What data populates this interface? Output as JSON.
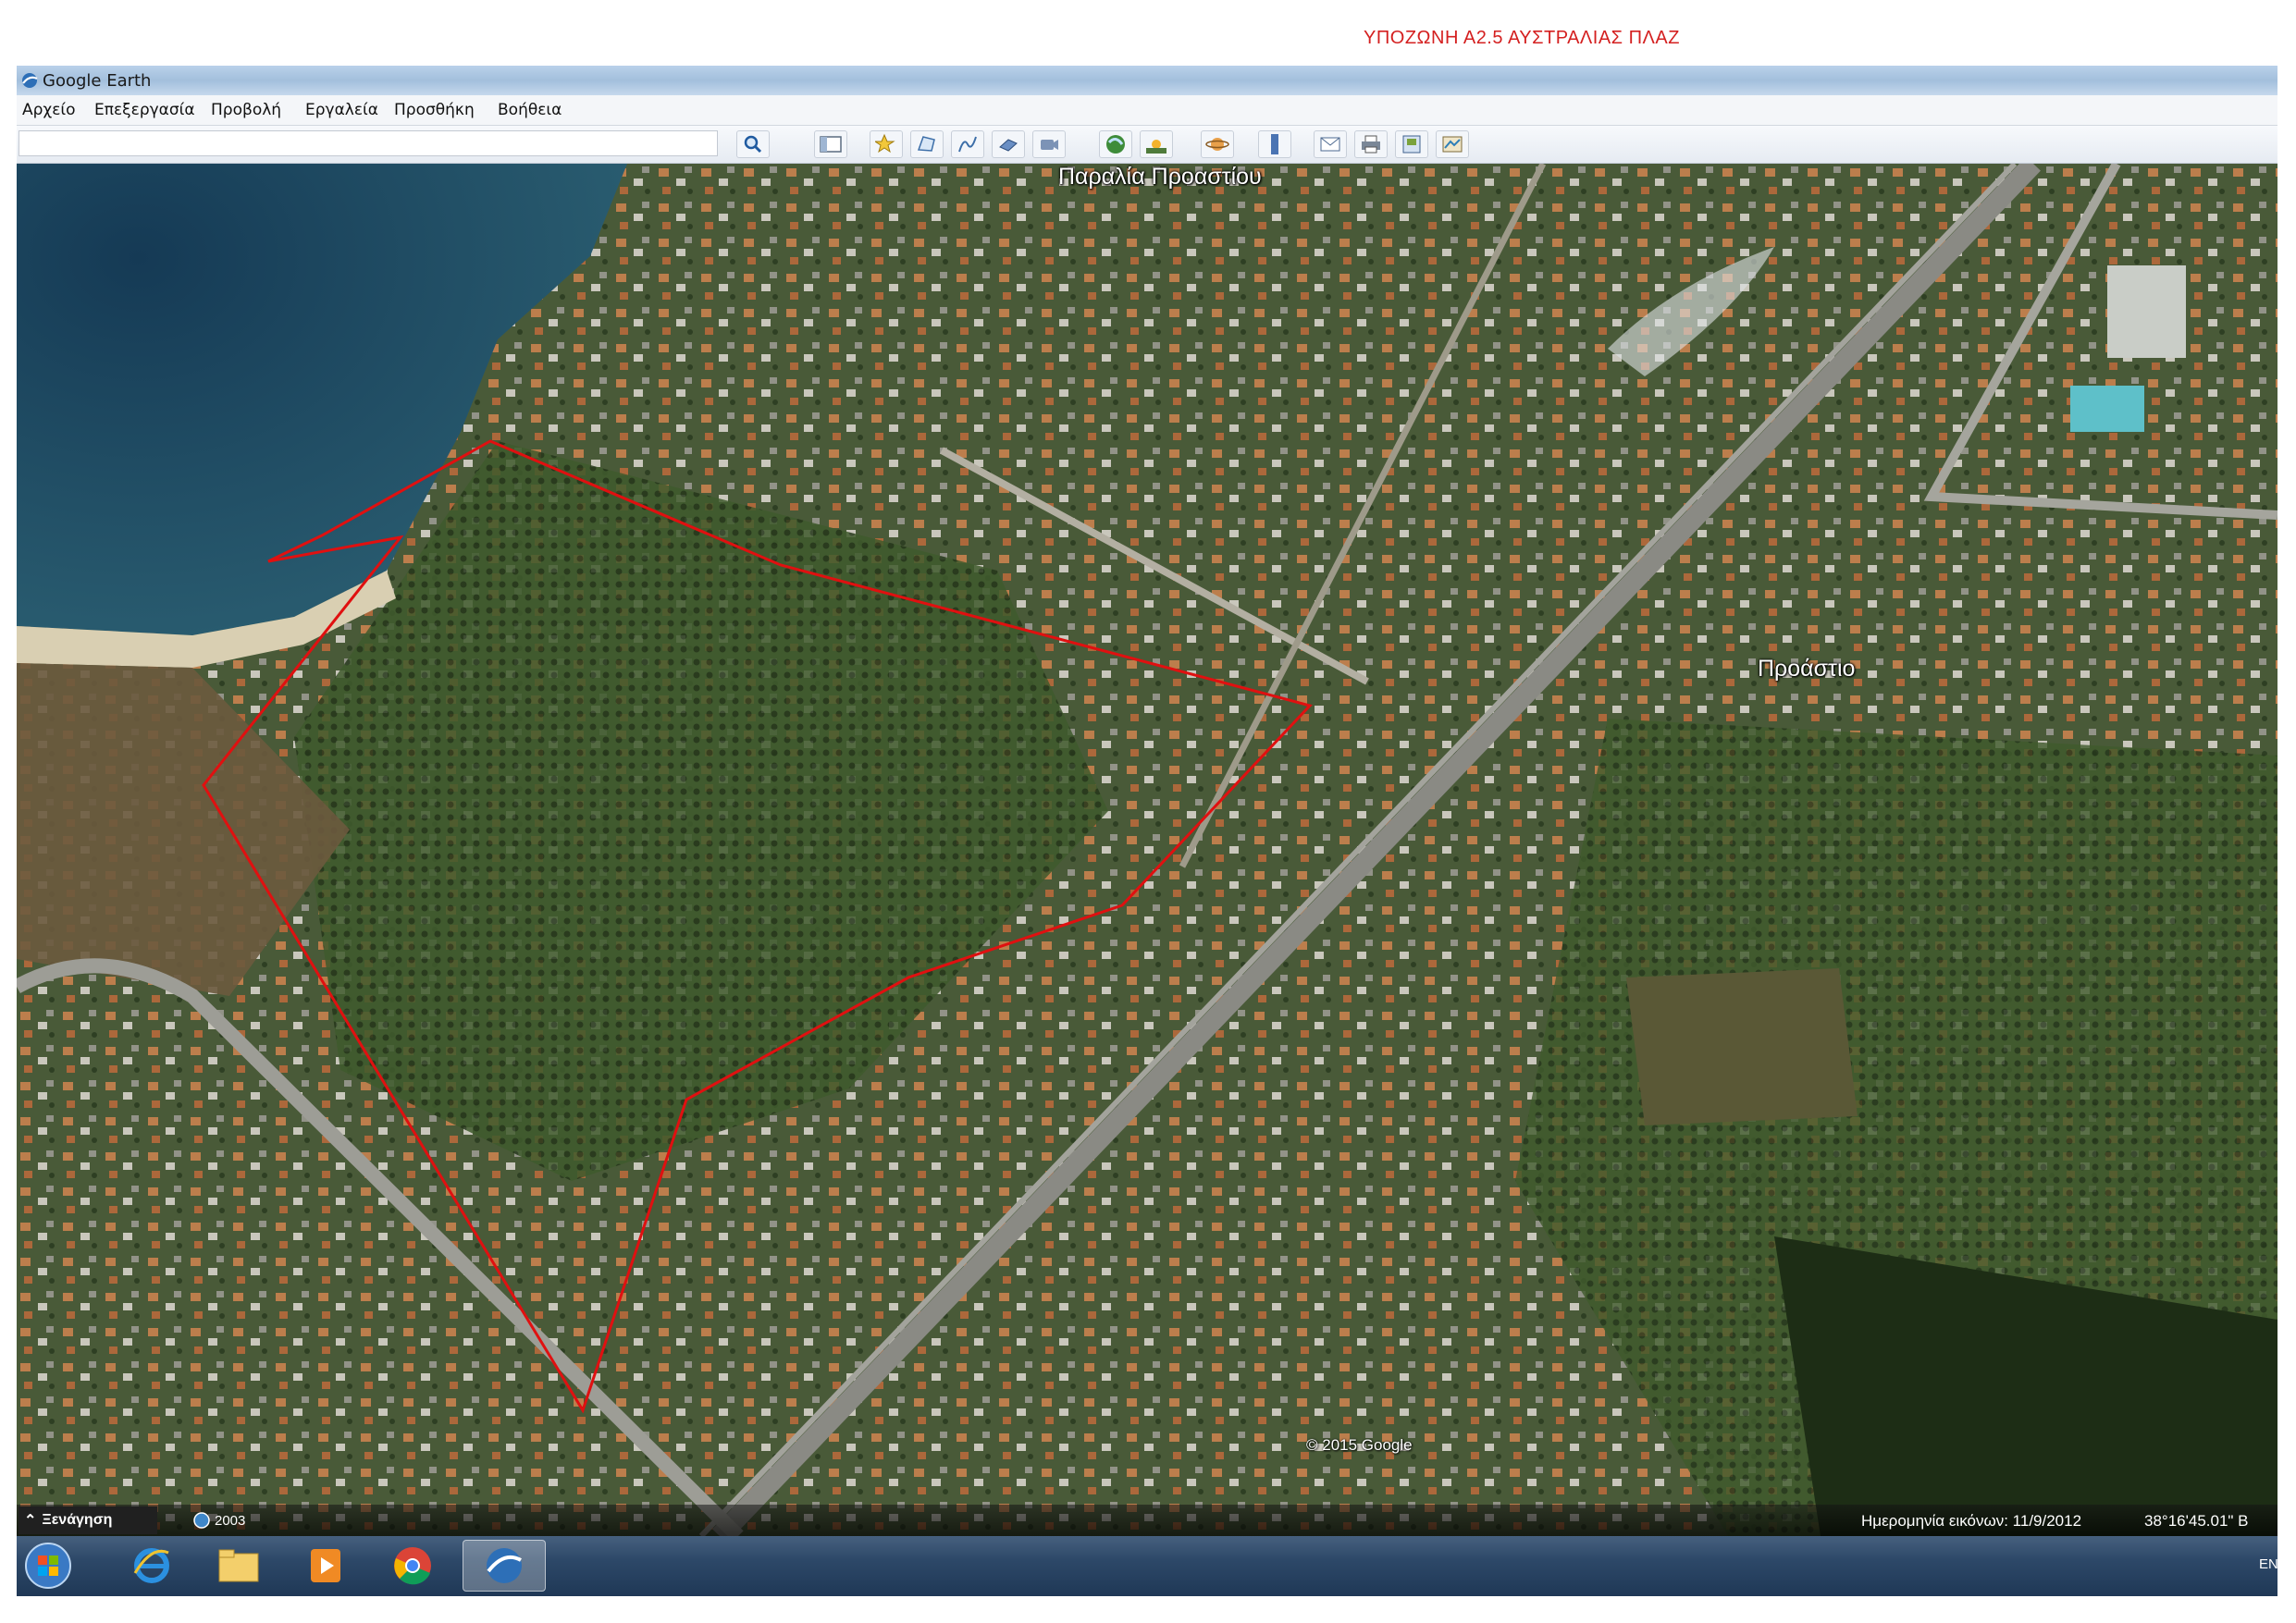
{
  "document": {
    "header": "ΥΠΟΖΩΝΗ  Α2.5 ΑΥΣΤΡΑΛΙΑΣ ΠΛΑΖ"
  },
  "window": {
    "title": "Google Earth",
    "menu": [
      "Αρχείο",
      "Επεξεργασία",
      "Προβολή",
      "Εργαλεία",
      "Προσθήκη",
      "Βοήθεια"
    ]
  },
  "search": {
    "value": "",
    "placeholder": ""
  },
  "toolbar": {
    "buttons": [
      "search-icon",
      "sidebar-icon",
      "placemark-icon",
      "polygon-icon",
      "path-icon",
      "image-overlay-icon",
      "record-tour-icon",
      "historical-imagery-icon",
      "sunlight-icon",
      "planet-icon",
      "ruler-icon",
      "email-icon",
      "print-icon",
      "save-image-icon",
      "view-in-maps-icon"
    ]
  },
  "map": {
    "labels": {
      "beach": "Παραλία Προαστίου",
      "town": "Προάστιο"
    },
    "copyright": "© 2015 Google",
    "boundary_color": "#e01010"
  },
  "status": {
    "tour_label": "Ξενάγηση",
    "year": "2003",
    "imagery_date": "Ημερομηνία εικόνων: 11/9/2012",
    "coordinates": "38°16'45.01\" Β"
  },
  "taskbar": {
    "language": "EN",
    "apps": [
      "start-icon",
      "internet-explorer-icon",
      "file-explorer-icon",
      "media-player-icon",
      "chrome-icon",
      "google-earth-icon"
    ]
  }
}
